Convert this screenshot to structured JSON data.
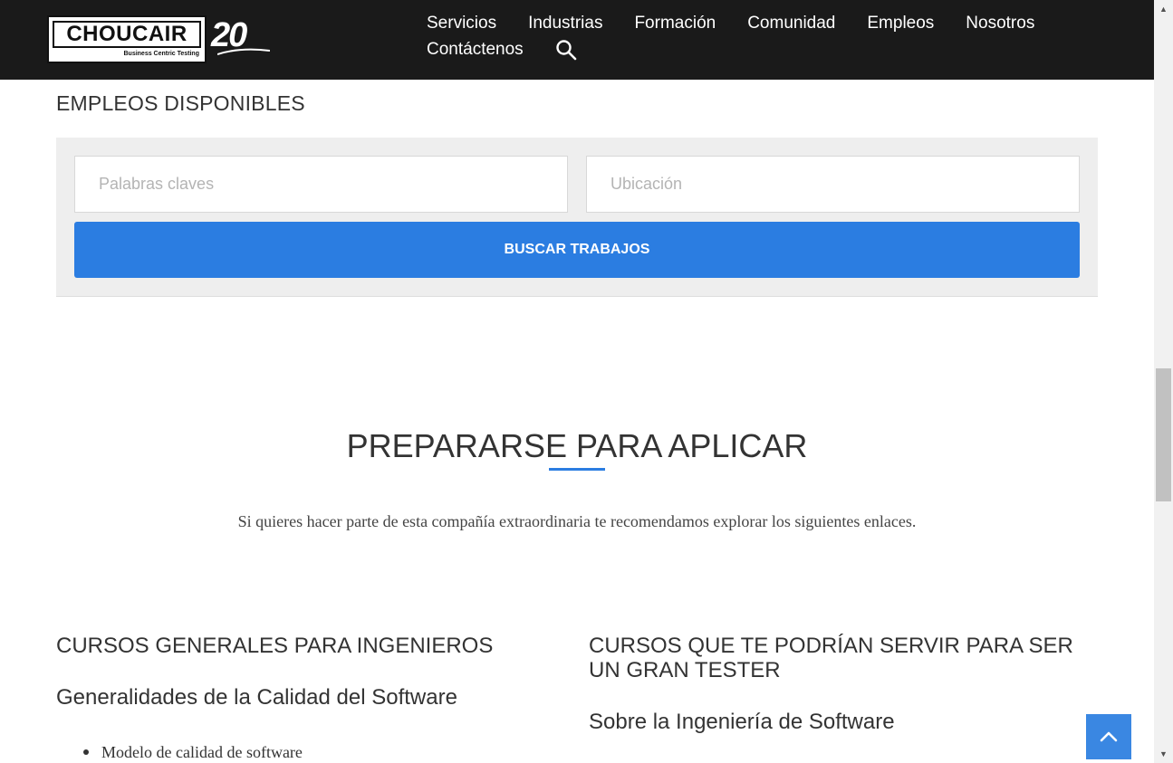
{
  "header": {
    "logo_text": "CHOUCAIR",
    "logo_tagline": "Business Centric Testing",
    "anniversary": "20",
    "nav": [
      {
        "label": "Servicios"
      },
      {
        "label": "Industrias"
      },
      {
        "label": "Formación"
      },
      {
        "label": "Comunidad"
      },
      {
        "label": "Empleos"
      },
      {
        "label": "Nosotros"
      },
      {
        "label": "Contáctenos"
      }
    ],
    "search_icon": "search-icon"
  },
  "jobs": {
    "title": "EMPLEOS DISPONIBLES",
    "keywords_placeholder": "Palabras claves",
    "location_placeholder": "Ubicación",
    "button_label": "BUSCAR TRABAJOS",
    "accent_color": "#2b7de1"
  },
  "prepare": {
    "title": "PREPARARSE PARA APLICAR",
    "description": "Si quieres hacer parte de esta compañía extraordinaria te recomendamos explorar los siguientes enlaces."
  },
  "columns": {
    "left": {
      "heading": "CURSOS GENERALES PARA INGENIEROS",
      "subheading": "Generalidades de la Calidad del Software",
      "items": [
        "Modelo de calidad de software"
      ]
    },
    "right": {
      "heading": "CURSOS QUE TE PODRÍAN SERVIR PARA SER UN GRAN TESTER",
      "subheading": "Sobre la Ingeniería de Software"
    }
  },
  "back_to_top_icon": "chevron-up-icon"
}
